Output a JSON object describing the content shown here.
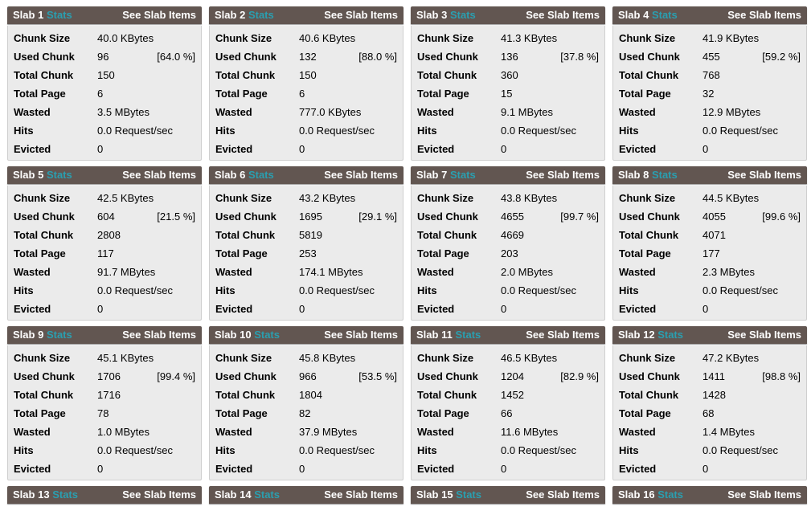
{
  "labels": {
    "slab_prefix": "Slab",
    "stats": "Stats",
    "see_items": "See Slab Items",
    "chunk_size": "Chunk Size",
    "used_chunk": "Used Chunk",
    "total_chunk": "Total Chunk",
    "total_page": "Total Page",
    "wasted": "Wasted",
    "hits": "Hits",
    "evicted": "Evicted"
  },
  "colors": {
    "header_bg": "#625651",
    "stats_link": "#2a9fb0",
    "body_bg": "#ebebeb"
  },
  "slabs": [
    {
      "id": "1",
      "chunk_size": "40.0 KBytes",
      "used_chunk": "96",
      "used_pct": "[64.0 %]",
      "total_chunk": "150",
      "total_page": "6",
      "wasted": "3.5 MBytes",
      "hits": "0.0 Request/sec",
      "evicted": "0"
    },
    {
      "id": "2",
      "chunk_size": "40.6 KBytes",
      "used_chunk": "132",
      "used_pct": "[88.0 %]",
      "total_chunk": "150",
      "total_page": "6",
      "wasted": "777.0 KBytes",
      "hits": "0.0 Request/sec",
      "evicted": "0"
    },
    {
      "id": "3",
      "chunk_size": "41.3 KBytes",
      "used_chunk": "136",
      "used_pct": "[37.8 %]",
      "total_chunk": "360",
      "total_page": "15",
      "wasted": "9.1 MBytes",
      "hits": "0.0 Request/sec",
      "evicted": "0"
    },
    {
      "id": "4",
      "chunk_size": "41.9 KBytes",
      "used_chunk": "455",
      "used_pct": "[59.2 %]",
      "total_chunk": "768",
      "total_page": "32",
      "wasted": "12.9 MBytes",
      "hits": "0.0 Request/sec",
      "evicted": "0"
    },
    {
      "id": "5",
      "chunk_size": "42.5 KBytes",
      "used_chunk": "604",
      "used_pct": "[21.5 %]",
      "total_chunk": "2808",
      "total_page": "117",
      "wasted": "91.7 MBytes",
      "hits": "0.0 Request/sec",
      "evicted": "0"
    },
    {
      "id": "6",
      "chunk_size": "43.2 KBytes",
      "used_chunk": "1695",
      "used_pct": "[29.1 %]",
      "total_chunk": "5819",
      "total_page": "253",
      "wasted": "174.1 MBytes",
      "hits": "0.0 Request/sec",
      "evicted": "0"
    },
    {
      "id": "7",
      "chunk_size": "43.8 KBytes",
      "used_chunk": "4655",
      "used_pct": "[99.7 %]",
      "total_chunk": "4669",
      "total_page": "203",
      "wasted": "2.0 MBytes",
      "hits": "0.0 Request/sec",
      "evicted": "0"
    },
    {
      "id": "8",
      "chunk_size": "44.5 KBytes",
      "used_chunk": "4055",
      "used_pct": "[99.6 %]",
      "total_chunk": "4071",
      "total_page": "177",
      "wasted": "2.3 MBytes",
      "hits": "0.0 Request/sec",
      "evicted": "0"
    },
    {
      "id": "9",
      "chunk_size": "45.1 KBytes",
      "used_chunk": "1706",
      "used_pct": "[99.4 %]",
      "total_chunk": "1716",
      "total_page": "78",
      "wasted": "1.0 MBytes",
      "hits": "0.0 Request/sec",
      "evicted": "0"
    },
    {
      "id": "10",
      "chunk_size": "45.8 KBytes",
      "used_chunk": "966",
      "used_pct": "[53.5 %]",
      "total_chunk": "1804",
      "total_page": "82",
      "wasted": "37.9 MBytes",
      "hits": "0.0 Request/sec",
      "evicted": "0"
    },
    {
      "id": "11",
      "chunk_size": "46.5 KBytes",
      "used_chunk": "1204",
      "used_pct": "[82.9 %]",
      "total_chunk": "1452",
      "total_page": "66",
      "wasted": "11.6 MBytes",
      "hits": "0.0 Request/sec",
      "evicted": "0"
    },
    {
      "id": "12",
      "chunk_size": "47.2 KBytes",
      "used_chunk": "1411",
      "used_pct": "[98.8 %]",
      "total_chunk": "1428",
      "total_page": "68",
      "wasted": "1.4 MBytes",
      "hits": "0.0 Request/sec",
      "evicted": "0"
    },
    {
      "id": "13"
    },
    {
      "id": "14"
    },
    {
      "id": "15"
    },
    {
      "id": "16"
    }
  ]
}
